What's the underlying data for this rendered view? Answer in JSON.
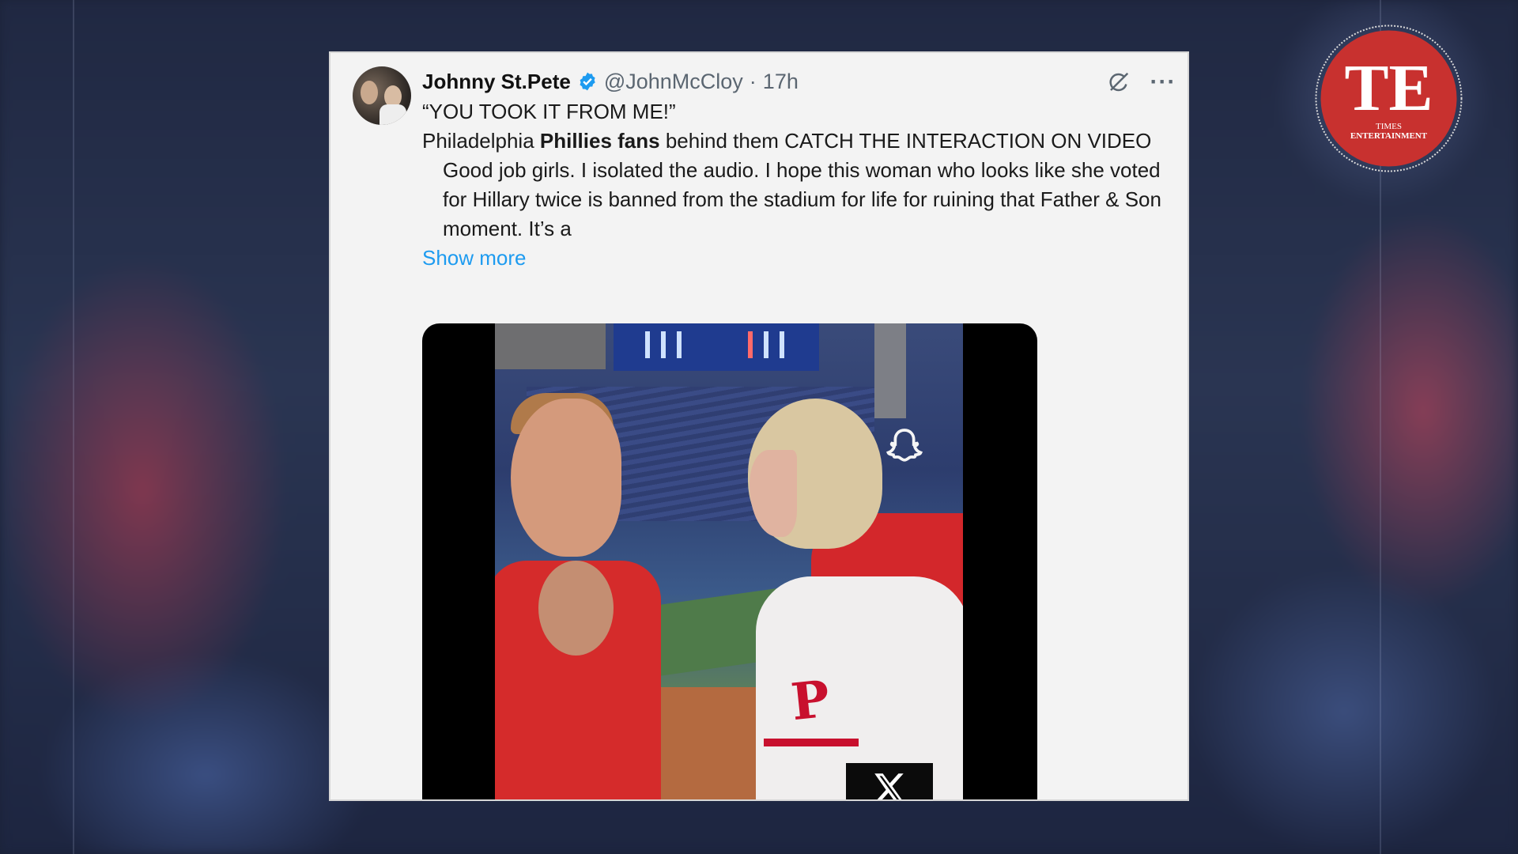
{
  "tweet": {
    "display_name": "Johnny St.Pete",
    "handle": "@JohnMcCloy",
    "separator": "·",
    "time": "17h",
    "line1": "“YOU TOOK IT FROM ME!”",
    "line2_pre": "Philadelphia ",
    "line2_bold": "Phillies fans",
    "line2_post": " behind them CATCH THE INTERACTION ON VIDEO",
    "line3": "Good job girls. I isolated the audio. I hope this woman who looks like she voted for Hillary twice is banned from the stadium for life for ruining that Father & Son moment. It’s a",
    "show_more": "Show more",
    "icons": [
      "verified-badge-icon",
      "grok-icon",
      "more-icon"
    ]
  },
  "media": {
    "jersey_letter": "P",
    "badge_icon": "x-logo-icon",
    "overlay_icon": "snapchat-ghost-icon"
  },
  "logo": {
    "letters": "TE",
    "caption_line1": "TIMES",
    "caption_line2": "ENTERTAINMENT"
  },
  "colors": {
    "accent_link": "#1d9bf0",
    "verified": "#1d9bf0",
    "logo_red": "#c8312f"
  }
}
